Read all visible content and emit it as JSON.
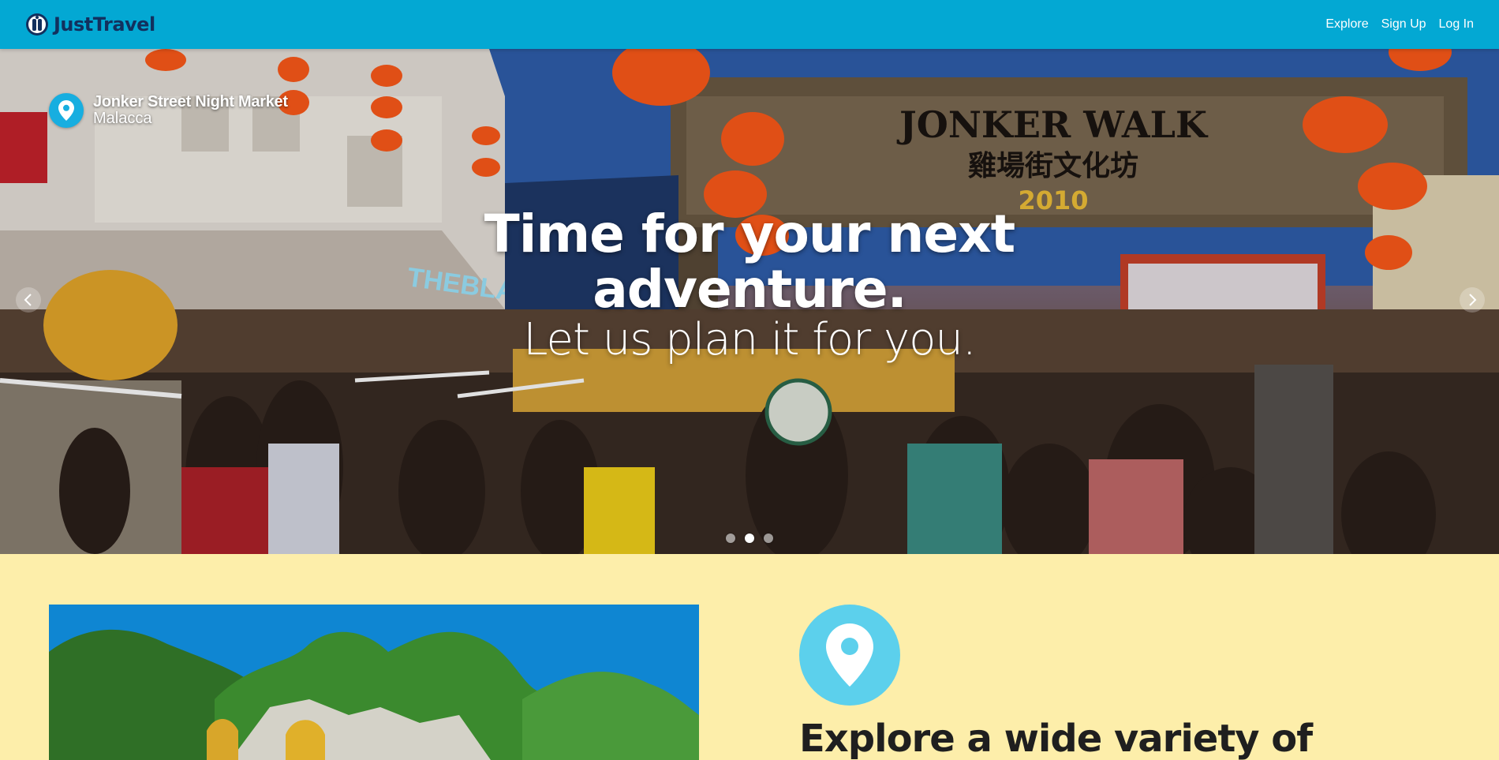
{
  "brand": {
    "name": "JustTravel",
    "logo_icon": "traveller-logo-icon"
  },
  "nav": {
    "items": [
      {
        "label": "Explore"
      },
      {
        "label": "Sign Up"
      },
      {
        "label": "Log In"
      }
    ]
  },
  "hero": {
    "location": {
      "name": "Jonker Street Night Market",
      "city": "Malacca",
      "icon": "map-pin-icon"
    },
    "title": "Time for your next adventure.",
    "subtitle": "Let us plan it for you.",
    "scene_sign": {
      "title": "JONKER WALK",
      "chinese": "雞場街文化坊",
      "year": "2010"
    },
    "shop_sign": "THEBLANC",
    "carousel": {
      "prev_icon": "chevron-left-icon",
      "next_icon": "chevron-right-icon",
      "slide_count": 3,
      "active_slide": 2
    }
  },
  "feature": {
    "icon": "map-pin-icon",
    "heading": "Explore a wide variety of"
  },
  "colors": {
    "navbar": "#03a8d3",
    "brand_text": "#12305e",
    "page_background": "#fdeeaa",
    "pin_badge": "#17aee0",
    "feature_icon_circle": "#5cd0ec",
    "heading_text": "#1f1f1f"
  }
}
